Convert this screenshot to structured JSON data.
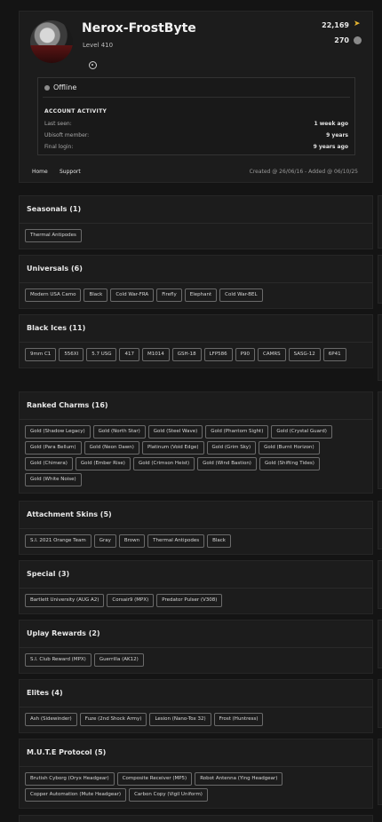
{
  "profile": {
    "username": "Nerox-FrostByte",
    "level": "Level 410",
    "credits": "22,169",
    "renown": "270",
    "status": "Offline",
    "activity_title": "ACCOUNT ACTIVITY",
    "activity": [
      {
        "label": "Last seen:",
        "value": "1 week ago"
      },
      {
        "label": "Ubisoft member:",
        "value": "9 years"
      },
      {
        "label": "Final login:",
        "value": "9 years ago"
      }
    ],
    "nav": {
      "home": "Home",
      "support": "Support"
    },
    "created": "Created @ 26/06/16 - Added @ 06/10/25",
    "icons": {
      "platform": "steam-icon",
      "credits": "r6-credits-icon",
      "renown": "renown-coin-icon",
      "status": "status-dot-icon"
    }
  },
  "sections": [
    {
      "title": "Seasonals (1)",
      "items": [
        "Thermal Antipodes"
      ]
    },
    {
      "title": "Universals (6)",
      "items": [
        "Modern USA Camo",
        "Black",
        "Cold War-FRA",
        "Firefly",
        "Elephant",
        "Cold War-BEL"
      ]
    },
    {
      "title": "Black Ices (11)",
      "items": [
        "9mm C1",
        "556XI",
        "5.7 USG",
        "417",
        "M1014",
        "GSH-18",
        "LFP586",
        "P90",
        "CAMRS",
        "SASG-12",
        "6P41"
      ]
    },
    {
      "title": "Ranked Charms (16)",
      "items": [
        "Gold (Shadow Legacy)",
        "Gold (North Star)",
        "Gold (Steel Wave)",
        "Gold (Phantom Sight)",
        "Gold (Crystal Guard)",
        "Gold (Para Bellum)",
        "Gold (Neon Dawn)",
        "Platinum (Void Edge)",
        "Gold (Grim Sky)",
        "Gold (Burnt Horizon)",
        "Gold (Chimera)",
        "Gold (Ember Rise)",
        "Gold (Crimson Heist)",
        "Gold (Wind Bastion)",
        "Gold (Shifting Tides)",
        "Gold (White Noise)"
      ]
    },
    {
      "title": "Attachment Skins (5)",
      "items": [
        "S.I. 2021 Orange Team",
        "Gray",
        "Brown",
        "Thermal Antipodes",
        "Black"
      ]
    },
    {
      "title": "Special (3)",
      "items": [
        "Bartlett University (AUG A2)",
        "Corsair9 (MPX)",
        "Predator Pulser (V308)"
      ]
    },
    {
      "title": "Uplay Rewards (2)",
      "items": [
        "S.I. Club Reward (MPX)",
        "Guerrilla (AK12)"
      ]
    },
    {
      "title": "Elites (4)",
      "items": [
        "Ash (Sidewinder)",
        "Fuze (2nd Shock Army)",
        "Lesion (Nano-Tox 32)",
        "Frost (Huntress)"
      ]
    },
    {
      "title": "M.U.T.E Protocol (5)",
      "items": [
        "Brutish Cyborg (Oryx Headgear)",
        "Composite Receiver (MP5)",
        "Robot Antenna (Ying Headgear)",
        "Copper Automation (Mute Headgear)",
        "Carbon Copy (Vigil Uniform)"
      ]
    }
  ]
}
